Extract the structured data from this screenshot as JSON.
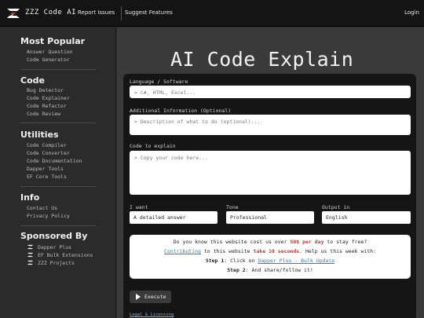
{
  "header": {
    "brand": "ZZZ Code AI",
    "nav": [
      "Report Issues",
      "Suggest Features"
    ],
    "login": "Login"
  },
  "sidebar": {
    "sections": [
      {
        "title": "Most Popular",
        "items": [
          "Answer Question",
          "Code Generator"
        ]
      },
      {
        "title": "Code",
        "items": [
          "Bug Detector",
          "Code Explainer",
          "Code Refactor",
          "Code Review"
        ]
      },
      {
        "title": "Utilities",
        "items": [
          "Code Compiler",
          "Code Converter",
          "Code Documentation",
          "Dapper Tools",
          "EF Core Tools"
        ]
      },
      {
        "title": "Info",
        "items": [
          "Contact Us",
          "Privacy Policy"
        ]
      }
    ],
    "sponsored": {
      "title": "Sponsored By",
      "items": [
        "Dapper Plus",
        "EF Bulk Extensions",
        "ZZZ Projects"
      ]
    }
  },
  "main": {
    "title": "AI Code Explain",
    "language": {
      "label": "Language / Software",
      "placeholder": "> C#, HTML, Excel..."
    },
    "additional": {
      "label": "Additional Information (Optional)",
      "placeholder": "> Description of what to do (optional)..."
    },
    "code": {
      "label": "Code to explain",
      "placeholder": "> Copy your code here..."
    },
    "want": {
      "label": "I want",
      "value": "A detailed answer"
    },
    "tone": {
      "label": "Tone",
      "value": "Professional"
    },
    "output": {
      "label": "Output in",
      "value": "English"
    },
    "notice": {
      "l1_a": "Do you know this website cost us over ",
      "l1_b": "50$ per day",
      "l1_c": " to stay free?",
      "l2_a": "Contributing",
      "l2_b": " to this website ",
      "l2_c": "take 10 seconds",
      "l2_d": ". Help us this week with:",
      "l3_a": "Step 1",
      "l3_b": ": Click on ",
      "l3_c": "Dapper Plus - Bulk Update",
      "l4_a": "Step 2",
      "l4_b": ": And share/follow it!"
    },
    "execute": "Execute",
    "legal": "Legal & Licensing"
  },
  "colors": {
    "topbar": "#141414",
    "sidebar": "#2b2b2b",
    "main": "#3a3a3a",
    "panel": "#151515",
    "accent_red": "#c0392b",
    "link_blue": "#2a7fbf"
  },
  "icons": {
    "logo": "zzz-logo-icon",
    "sponsor": "zzz-logo-icon",
    "execute": "play-icon"
  }
}
